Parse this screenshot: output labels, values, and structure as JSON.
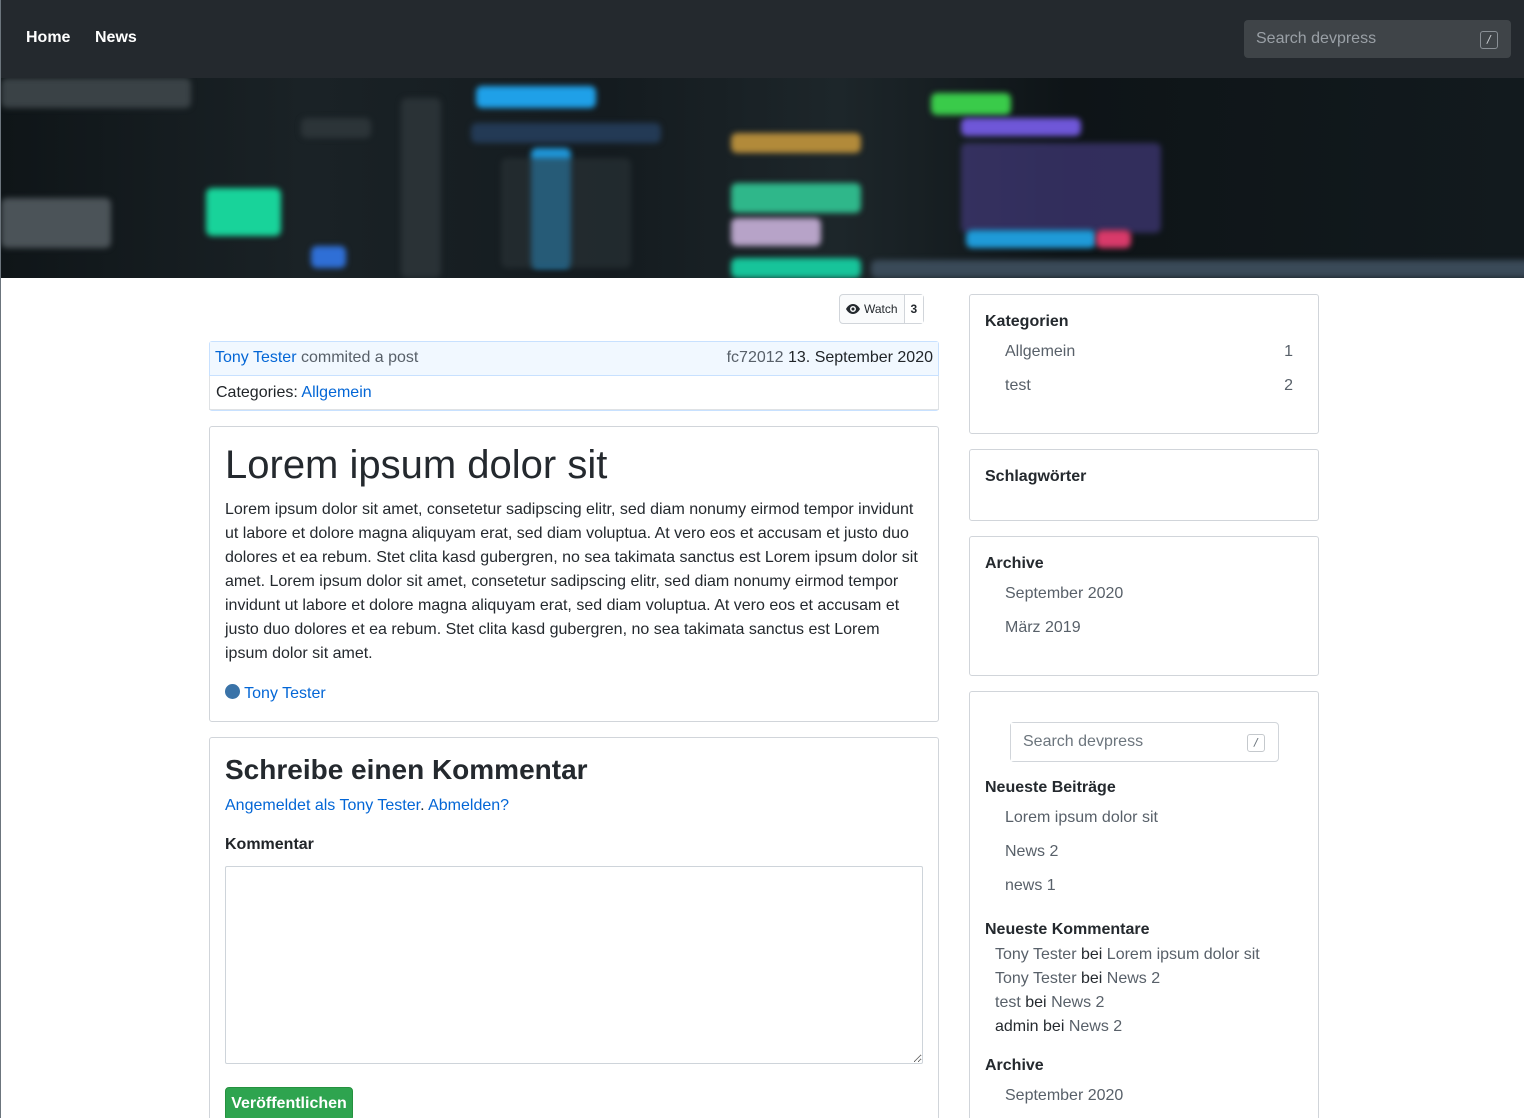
{
  "nav": {
    "links": [
      "Home",
      "News"
    ],
    "search_placeholder": "Search devpress",
    "search_key": "/"
  },
  "watch": {
    "label": "Watch",
    "count": "3"
  },
  "commit": {
    "author": "Tony Tester",
    "action": "commited a post",
    "hash": "fc72012",
    "date": "13. September 2020",
    "categories_label": "Categories:",
    "category": "Allgemein"
  },
  "post": {
    "title": "Lorem ipsum dolor sit",
    "text": "Lorem ipsum dolor sit amet, consetetur sadipscing elitr, sed diam nonumy eirmod tempor invidunt ut labore et dolore magna aliquyam erat, sed diam voluptua. At vero eos et accusam et justo duo dolores et ea rebum. Stet clita kasd gubergren, no sea takimata sanctus est Lorem ipsum dolor sit amet. Lorem ipsum dolor sit amet, consetetur sadipscing elitr, sed diam nonumy eirmod tempor invidunt ut labore et dolore magna aliquyam erat, sed diam voluptua. At vero eos et accusam et justo duo dolores et ea rebum. Stet clita kasd gubergren, no sea takimata sanctus est Lorem ipsum dolor sit amet.",
    "author": "Tony Tester"
  },
  "comment_form": {
    "title": "Schreibe einen Kommentar",
    "logged_in": "Angemeldet als Tony Tester",
    "separator": ".",
    "logout": "Abmelden?",
    "label": "Kommentar",
    "submit": "Veröffentlichen"
  },
  "sidebar": {
    "categories": {
      "title": "Kategorien",
      "items": [
        {
          "name": "Allgemein",
          "count": "1"
        },
        {
          "name": "test",
          "count": "2"
        }
      ]
    },
    "tags": {
      "title": "Schlagwörter"
    },
    "archive": {
      "title": "Archive",
      "items": [
        "September 2020",
        "März 2019"
      ]
    },
    "search": {
      "placeholder": "Search devpress",
      "key": "/"
    },
    "recent_posts": {
      "title": "Neueste Beiträge",
      "items": [
        "Lorem ipsum dolor sit",
        "News 2",
        "news 1"
      ]
    },
    "recent_comments": {
      "title": "Neueste Kommentare",
      "items": [
        {
          "author": "Tony Tester",
          "bei": "bei",
          "post": "Lorem ipsum dolor sit"
        },
        {
          "author": "Tony Tester",
          "bei": "bei",
          "post": "News 2"
        },
        {
          "author": "test",
          "bei": "bei",
          "post": "News 2"
        },
        {
          "author": "admin",
          "bei": "bei",
          "post": "News 2"
        }
      ]
    },
    "archive2": {
      "title": "Archive",
      "items": [
        "September 2020"
      ]
    }
  }
}
